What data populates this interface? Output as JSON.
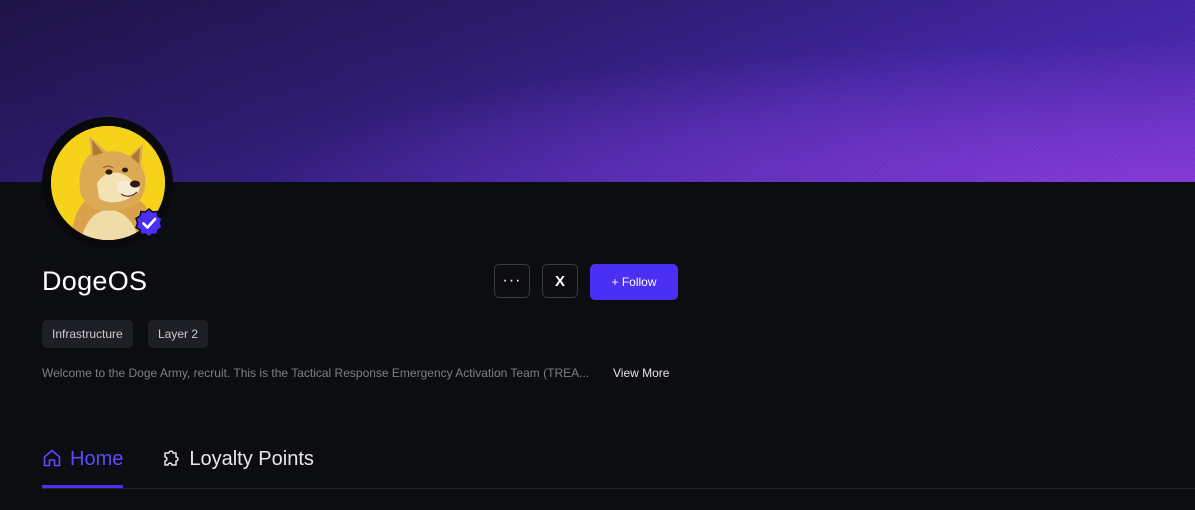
{
  "profile": {
    "name": "DogeOS",
    "tags": [
      "Infrastructure",
      "Layer 2"
    ],
    "description": "Welcome to the Doge Army, recruit. This is the Tactical Response Emergency Activation Team (TREA...",
    "view_more": "View More",
    "avatar_icon": "doge-avatar",
    "verified_icon": "verified-badge-icon"
  },
  "actions": {
    "more_label": "···",
    "x_label": "X",
    "follow_label": "+ Follow"
  },
  "tabs": [
    {
      "label": "Home",
      "icon": "home-icon",
      "active": true
    },
    {
      "label": "Loyalty Points",
      "icon": "puzzle-icon",
      "active": false
    }
  ],
  "colors": {
    "accent": "#4a2ff5",
    "background": "#0c0d10",
    "tag_bg": "#1e1f24"
  }
}
